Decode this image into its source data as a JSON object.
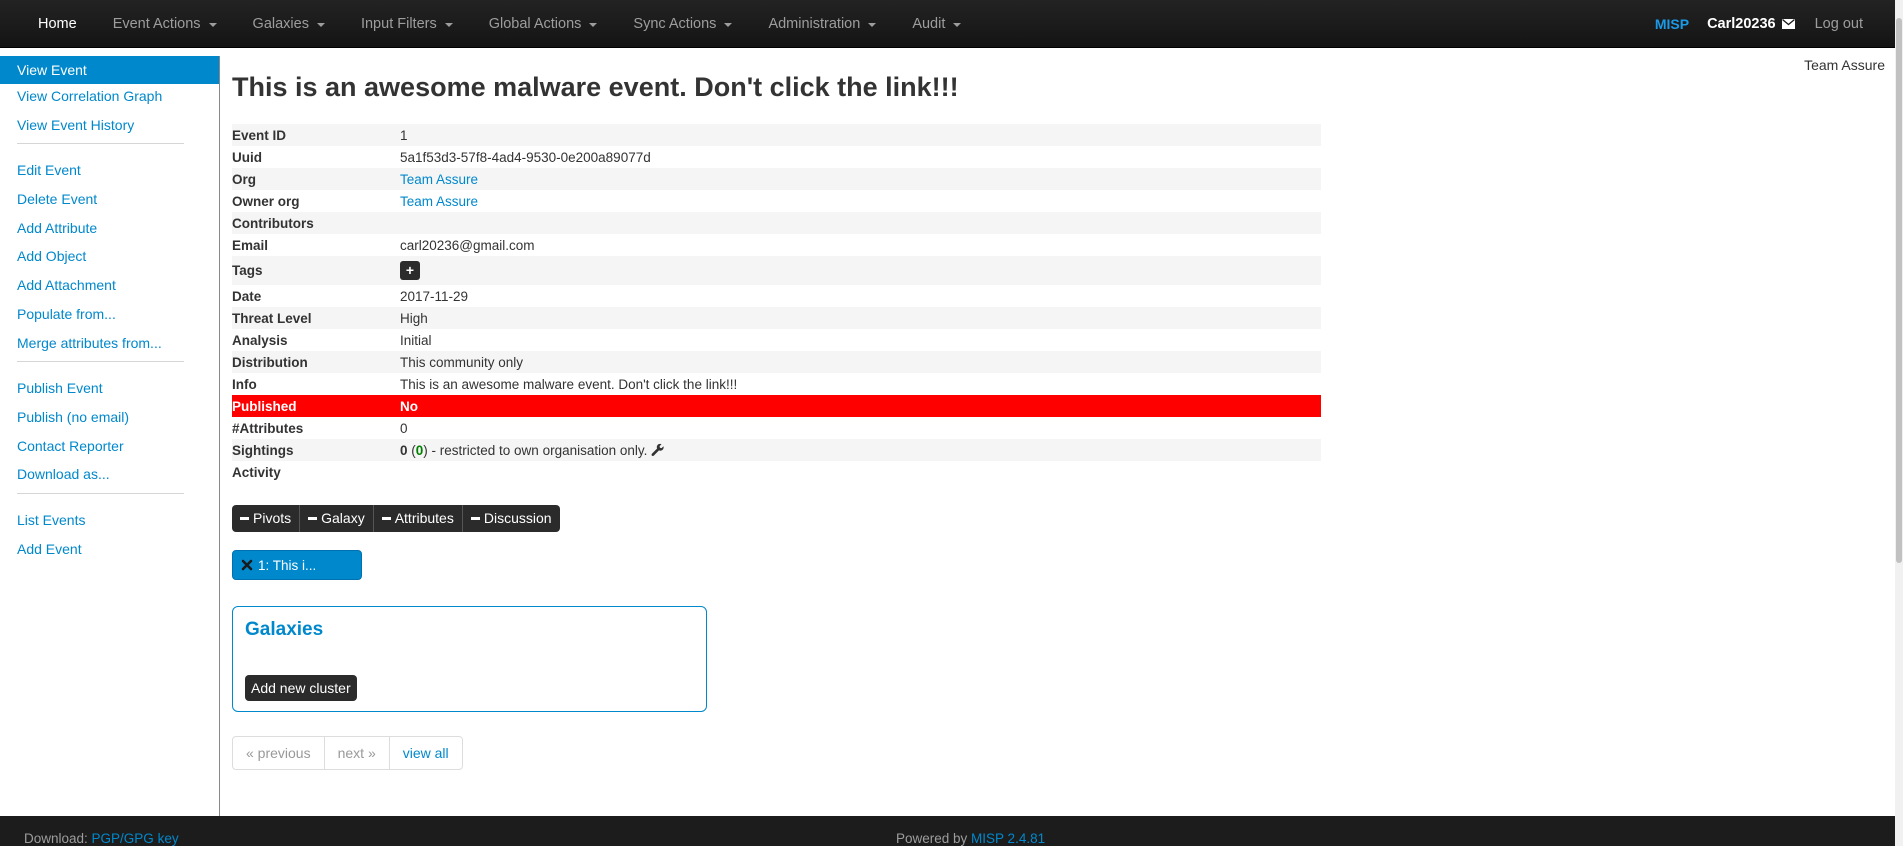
{
  "navbar": {
    "home": "Home",
    "menus": [
      "Event Actions",
      "Galaxies",
      "Input Filters",
      "Global Actions",
      "Sync Actions",
      "Administration",
      "Audit"
    ],
    "misp": "MISP",
    "user": "Carl20236",
    "logout": "Log out"
  },
  "sidebar": {
    "view_event": "View Event",
    "view_correlation_graph": "View Correlation Graph",
    "view_event_history": "View Event History",
    "edit_event": "Edit Event",
    "delete_event": "Delete Event",
    "add_attribute": "Add Attribute",
    "add_object": "Add Object",
    "add_attachment": "Add Attachment",
    "populate_from": "Populate from...",
    "merge_attributes": "Merge attributes from...",
    "publish_event": "Publish Event",
    "publish_no_email": "Publish (no email)",
    "contact_reporter": "Contact Reporter",
    "download_as": "Download as...",
    "list_events": "List Events",
    "add_event": "Add Event"
  },
  "org_corner": "Team Assure",
  "event": {
    "title": "This is an awesome malware event. Don't click the link!!!",
    "labels": {
      "event_id": "Event ID",
      "uuid": "Uuid",
      "org": "Org",
      "owner_org": "Owner org",
      "contributors": "Contributors",
      "email": "Email",
      "tags": "Tags",
      "date": "Date",
      "threat_level": "Threat Level",
      "analysis": "Analysis",
      "distribution": "Distribution",
      "info": "Info",
      "published": "Published",
      "attributes": "#Attributes",
      "sightings": "Sightings",
      "activity": "Activity"
    },
    "values": {
      "event_id": "1",
      "uuid": "5a1f53d3-57f8-4ad4-9530-0e200a89077d",
      "org": "Team Assure",
      "owner_org": "Team Assure",
      "contributors": "",
      "email": "carl20236@gmail.com",
      "tag_add": "+",
      "date": "2017-11-29",
      "threat_level": "High",
      "analysis": "Initial",
      "distribution": "This community only",
      "info": "This is an awesome malware event. Don't click the link!!!",
      "published": "No",
      "attributes": "0",
      "sightings_count": "0",
      "sightings_open": " (",
      "sightings_inner": "0",
      "sightings_rest": ") - restricted to own organisation only."
    }
  },
  "tabs": [
    "Pivots",
    "Galaxy",
    "Attributes",
    "Discussion"
  ],
  "pivot": "1: This i...",
  "galaxies": {
    "title": "Galaxies",
    "add_cluster": "Add new cluster"
  },
  "pager": {
    "previous": "« previous",
    "next": "next »",
    "view_all": "view all"
  },
  "footer": {
    "download_label": "Download: ",
    "download_link": "PGP/GPG key",
    "powered_label": "Powered by ",
    "powered_link": "MISP 2.4.81"
  },
  "colors": {
    "accent": "#0088cc",
    "navbar": "#1a1a1a",
    "published_no": "#ff0000",
    "misp_brand": "#1b9ae8"
  }
}
